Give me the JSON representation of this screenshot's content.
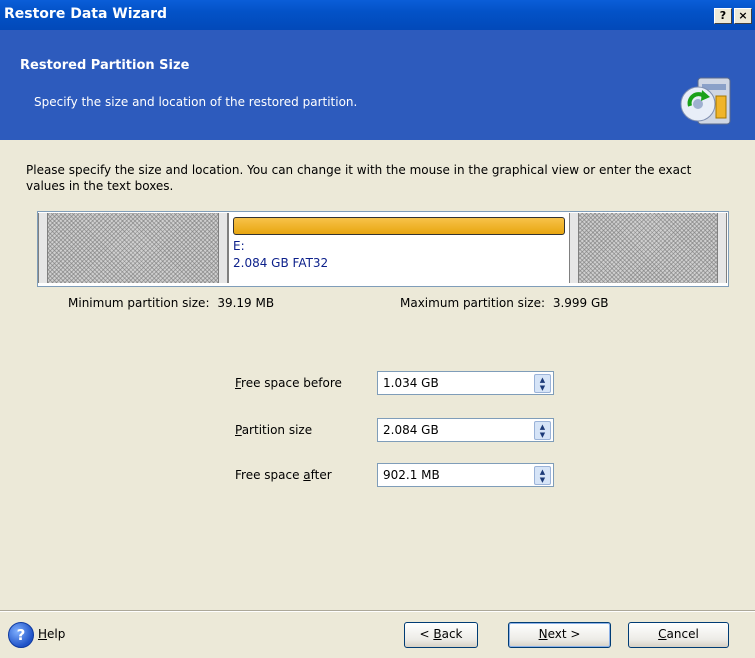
{
  "window": {
    "title": "Restore Data Wizard",
    "help_glyph": "?",
    "close_glyph": "×"
  },
  "header": {
    "title": "Restored Partition Size",
    "subtitle": "Specify the size and location of the restored partition.",
    "icon": "restore-disk-icon"
  },
  "instructions": "Please specify the size and location. You can change it with the mouse in the graphical view or enter the exact values in the text boxes.",
  "partition": {
    "drive": "E:",
    "info": "2.084 GB  FAT32",
    "bar_color": "#f0b429"
  },
  "limits": {
    "min_label": "Minimum partition size:",
    "min_value": "39.19 MB",
    "max_label": "Maximum partition size:",
    "max_value": "3.999 GB"
  },
  "fields": {
    "before": {
      "label_prefix": "",
      "accel": "F",
      "label_rest": "ree space before",
      "value": "1.034 GB"
    },
    "size": {
      "label_prefix": "",
      "accel": "P",
      "label_rest": "artition size",
      "value": "2.084 GB"
    },
    "after": {
      "label_prefix": "Free space ",
      "accel": "a",
      "label_rest": "fter",
      "value": "902.1 MB"
    }
  },
  "footer": {
    "help": {
      "accel": "H",
      "rest": "elp"
    },
    "back": {
      "prefix": "< ",
      "accel": "B",
      "rest": "ack"
    },
    "next": {
      "accel": "N",
      "rest": "ext >"
    },
    "cancel": {
      "accel": "C",
      "rest": "ancel"
    }
  },
  "colors": {
    "title_bar": "#0a5ed8",
    "header_bg": "#2d5bbd",
    "dialog_bg": "#ece9d8"
  }
}
